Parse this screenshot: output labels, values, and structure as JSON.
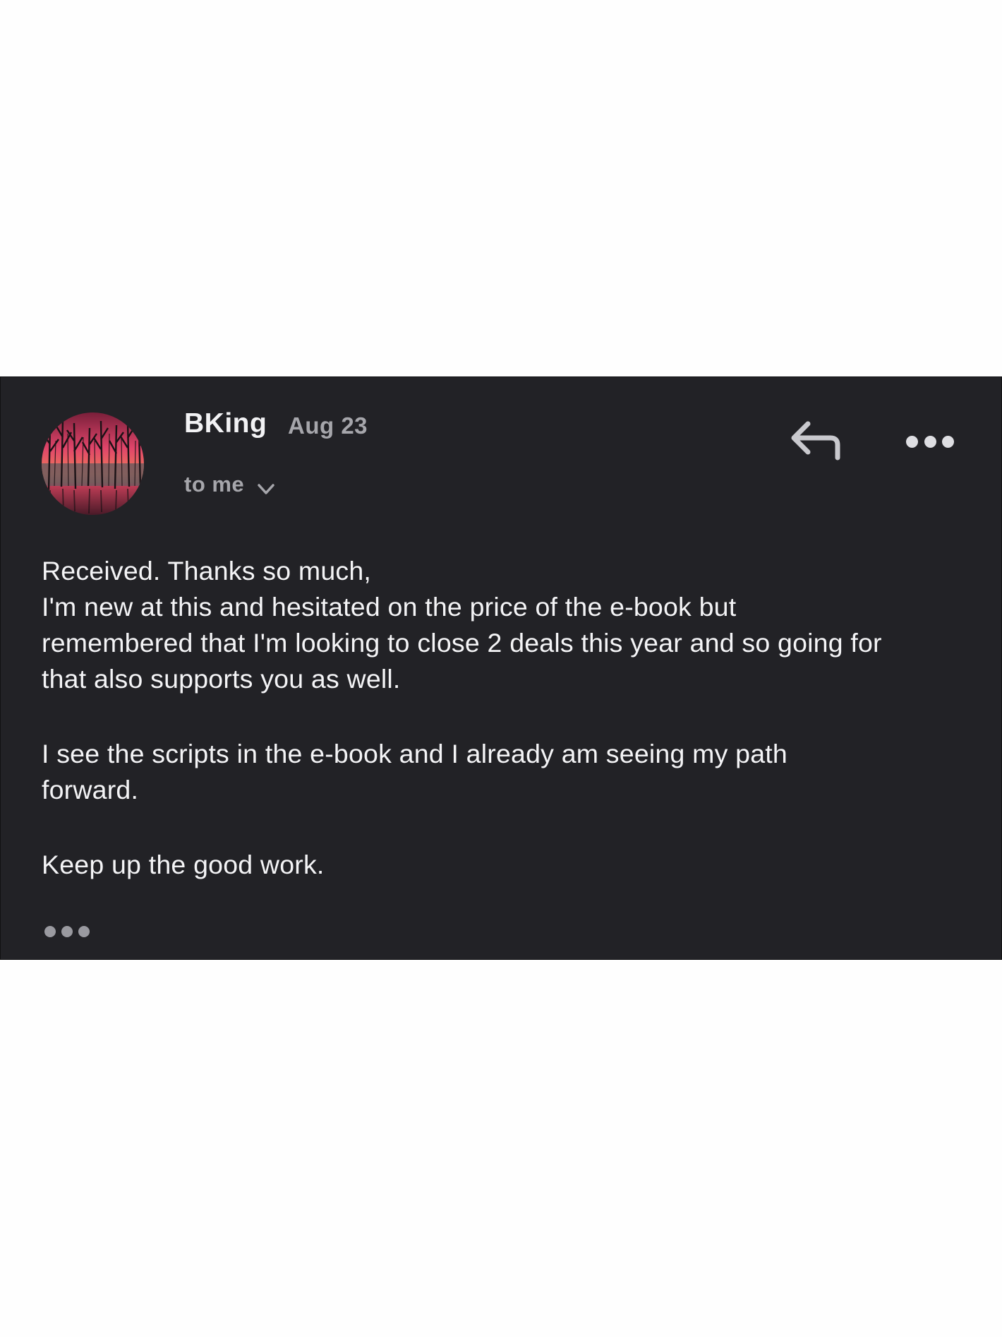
{
  "email": {
    "sender": "BKing",
    "date": "Aug 23",
    "recipient": "to me",
    "body": [
      "Received. Thanks so much,\nI'm new at this and hesitated on the price of the e-book but\nremembered that I'm looking to close 2 deals this year and so going for\nthat also supports you as well.",
      "I see the scripts in the e-book and I already am seeing my path\nforward.",
      "Keep up the good work."
    ]
  },
  "icons": {
    "avatar": "sunset-trees-avatar",
    "recipient_toggle": "chevron-down-icon",
    "reply": "reply-arrow-icon",
    "more": "more-horizontal-icon",
    "show_trimmed": "ellipsis-icon"
  },
  "colors": {
    "card_background": "#222226",
    "page_background": "#fefefe",
    "primary_text": "#f4f4f6",
    "secondary_text": "#a6a6ab"
  }
}
